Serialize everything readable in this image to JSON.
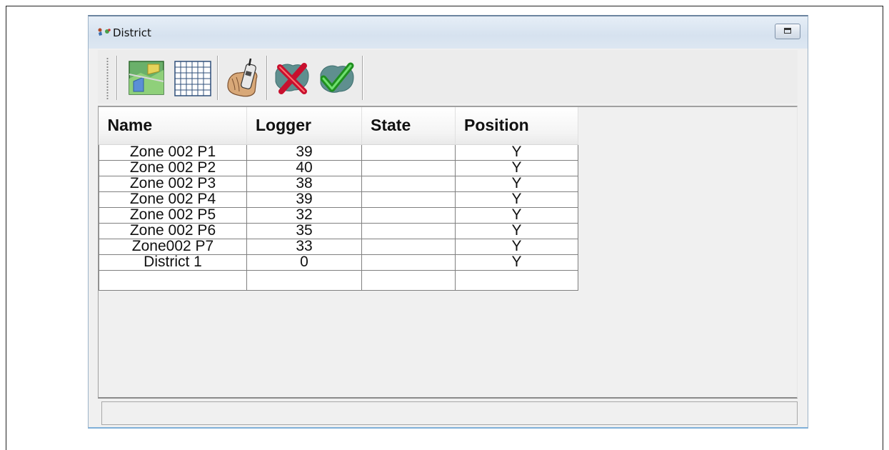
{
  "window": {
    "title": "District",
    "title_icon": "district-app-icon",
    "restore_icon": "restore-window-icon"
  },
  "toolbar": {
    "buttons": [
      {
        "name": "map-view-button",
        "icon": "map-icon"
      },
      {
        "name": "grid-view-button",
        "icon": "grid-table-icon"
      },
      {
        "name": "logger-device-button",
        "icon": "hand-logger-icon"
      },
      {
        "name": "delete-district-button",
        "icon": "red-x-map-icon"
      },
      {
        "name": "confirm-district-button",
        "icon": "green-check-map-icon"
      }
    ]
  },
  "table": {
    "columns": [
      "Name",
      "Logger",
      "State",
      "Position"
    ],
    "rows": [
      [
        "Zone 002 P1",
        "39",
        "",
        "Y"
      ],
      [
        "Zone 002 P2",
        "40",
        "",
        "Y"
      ],
      [
        "Zone 002 P3",
        "38",
        "",
        "Y"
      ],
      [
        "Zone 002 P4",
        "39",
        "",
        "Y"
      ],
      [
        "Zone 002 P5",
        "32",
        "",
        "Y"
      ],
      [
        "Zone 002 P6",
        "35",
        "",
        "Y"
      ],
      [
        "Zone002 P7",
        "33",
        "",
        "Y"
      ],
      [
        "District 1",
        "0",
        "",
        "Y"
      ],
      [
        "",
        "",
        "",
        ""
      ]
    ]
  },
  "statusbar": {
    "text": ""
  },
  "colors": {
    "titlebar": "#dae5f1",
    "window_border": "#7fb0d8",
    "background": "#f0f0f0"
  }
}
